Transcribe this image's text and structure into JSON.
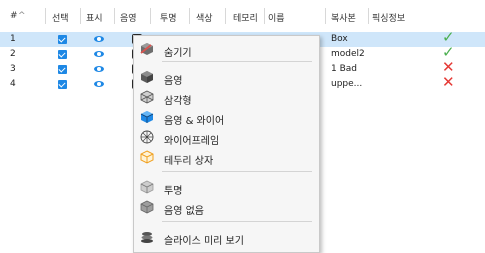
{
  "table": {
    "headers": [
      {
        "key": "num",
        "label": "#"
      },
      {
        "key": "select",
        "label": "선택"
      },
      {
        "key": "show",
        "label": "표시"
      },
      {
        "key": "shade",
        "label": "음영"
      },
      {
        "key": "transparent",
        "label": "투명"
      },
      {
        "key": "color",
        "label": "색상"
      },
      {
        "key": "border",
        "label": "테모리"
      },
      {
        "key": "name",
        "label": "이름"
      },
      {
        "key": "copy",
        "label": "복사본"
      },
      {
        "key": "correction",
        "label": "픽싱정보"
      }
    ],
    "sort_indicator": "^",
    "rows": [
      {
        "num": "1",
        "name": "Box",
        "status": "ok",
        "status_glyph": "✓",
        "selected": true
      },
      {
        "num": "2",
        "name": "model2",
        "status": "ok",
        "status_glyph": "✓",
        "selected": false
      },
      {
        "num": "3",
        "name": "1 Bad",
        "status": "error",
        "status_glyph": "✕",
        "selected": false
      },
      {
        "num": "4",
        "name": "uppe...",
        "status": "error",
        "status_glyph": "✕",
        "selected": false
      }
    ]
  },
  "context_menu": {
    "items": [
      {
        "label": "숨기기",
        "icon": "hide-icon"
      },
      {
        "label": "음영",
        "icon": "shaded-icon"
      },
      {
        "label": "삼각형",
        "icon": "triangle-icon"
      },
      {
        "label": "음영 & 와이어",
        "icon": "shaded-wire-icon"
      },
      {
        "label": "와이어프레임",
        "icon": "wireframe-icon"
      },
      {
        "label": "테두리 상자",
        "icon": "bounding-box-icon"
      },
      {
        "label": "투명",
        "icon": "transparent-icon"
      },
      {
        "label": "음영 없음",
        "icon": "no-shade-icon"
      },
      {
        "label": "슬라이스 미리 보기",
        "icon": "slice-preview-icon"
      }
    ]
  },
  "colors": {
    "accent": "#1e88e5",
    "selected_row": "#cfe6fa",
    "ok": "#4caf50",
    "error": "#e53935"
  }
}
